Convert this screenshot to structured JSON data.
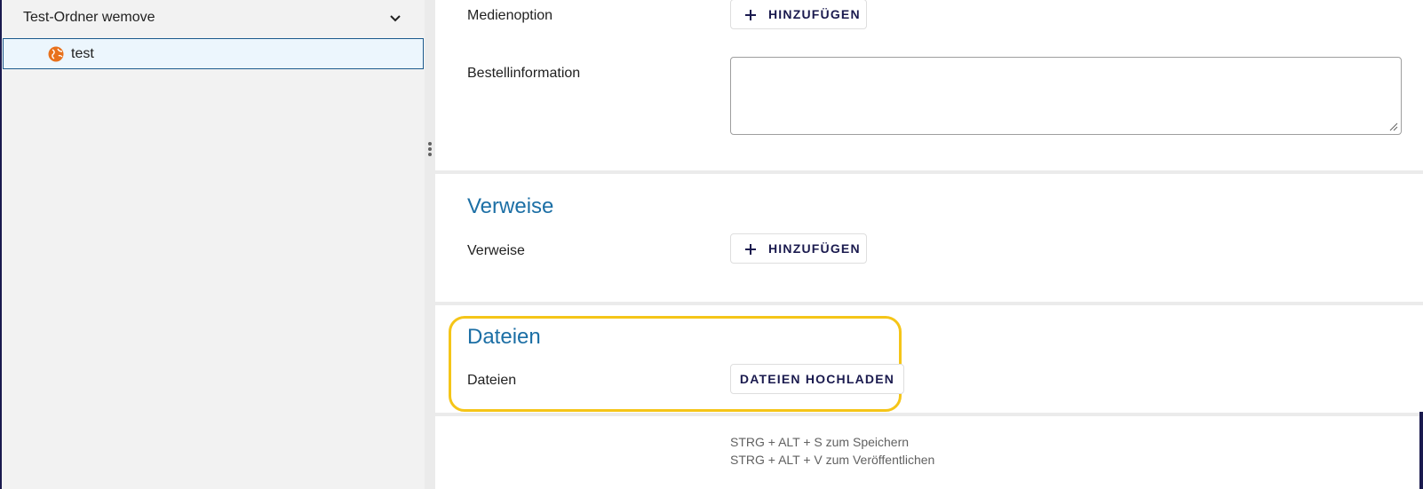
{
  "sidebar": {
    "folder_label": "Test-Ordner wemove",
    "item_label": "test"
  },
  "form": {
    "medienoption_label": "Medienoption",
    "add_button_label": "HINZUFÜGEN",
    "bestellinformation_label": "Bestellinformation",
    "bestellinformation_value": "",
    "verweise_section_title": "Verweise",
    "verweise_label": "Verweise",
    "dateien_section_title": "Dateien",
    "dateien_label": "Dateien",
    "upload_button_label": "DATEIEN HOCHLADEN"
  },
  "hints": {
    "save": "STRG + ALT + S zum Speichern",
    "publish": "STRG + ALT + V zum Veröffentlichen"
  },
  "colors": {
    "accent": "#1c6fa5",
    "highlight": "#f5c518",
    "selected_bg": "#ecf6fd",
    "globe_icon": "#e8711c"
  }
}
